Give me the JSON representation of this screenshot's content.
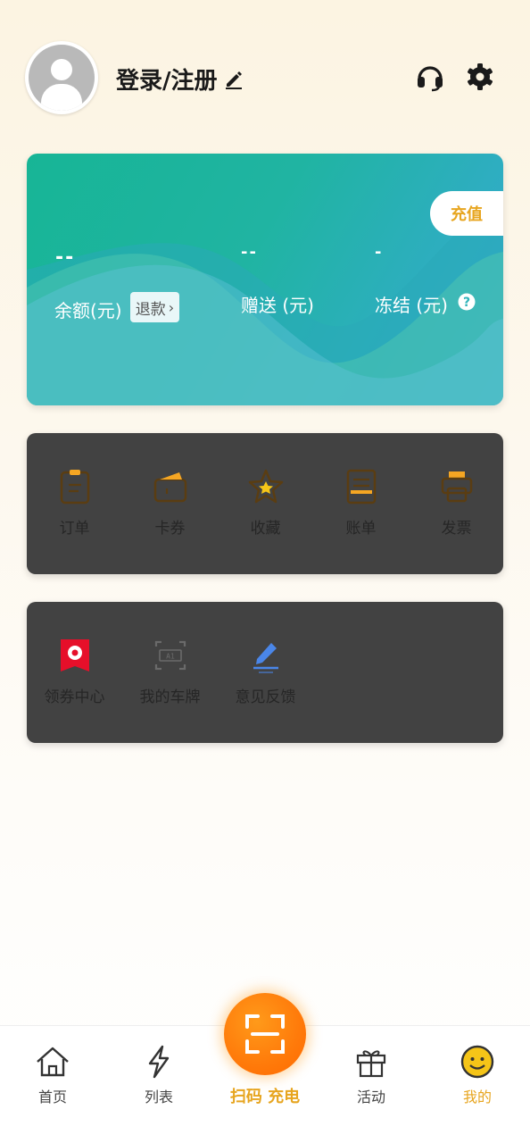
{
  "header": {
    "login_label": "登录/注册",
    "icons": [
      "edit-icon",
      "headset-icon",
      "settings-icon"
    ]
  },
  "card": {
    "recharge_label": "充值",
    "balance": {
      "value": "--",
      "label": "余额(元)",
      "refund_label": "退款"
    },
    "gift": {
      "value": "--",
      "label": "赠送 (元)"
    },
    "frozen": {
      "value": "-",
      "label": "冻结 (元)"
    },
    "colors": {
      "start": "#17b596",
      "end": "#38a9d6",
      "accent": "#e7a51f"
    }
  },
  "menu1": {
    "items": [
      {
        "label": "订单",
        "icon": "order-icon"
      },
      {
        "label": "卡券",
        "icon": "coupon-icon"
      },
      {
        "label": "收藏",
        "icon": "star-icon"
      },
      {
        "label": "账单",
        "icon": "bill-icon"
      },
      {
        "label": "发票",
        "icon": "invoice-icon"
      }
    ]
  },
  "menu2": {
    "items": [
      {
        "label": "领券中心",
        "icon": "coupon-center-icon"
      },
      {
        "label": "我的车牌",
        "icon": "license-plate-icon"
      },
      {
        "label": "意见反馈",
        "icon": "feedback-icon"
      }
    ]
  },
  "tabbar": {
    "items": [
      {
        "label": "首页",
        "icon": "home-icon"
      },
      {
        "label": "列表",
        "icon": "lightning-icon"
      },
      {
        "label": "扫码 充电",
        "icon": "scan-icon"
      },
      {
        "label": "活动",
        "icon": "gift-icon"
      },
      {
        "label": "我的",
        "icon": "smiley-icon",
        "active": true
      }
    ]
  }
}
